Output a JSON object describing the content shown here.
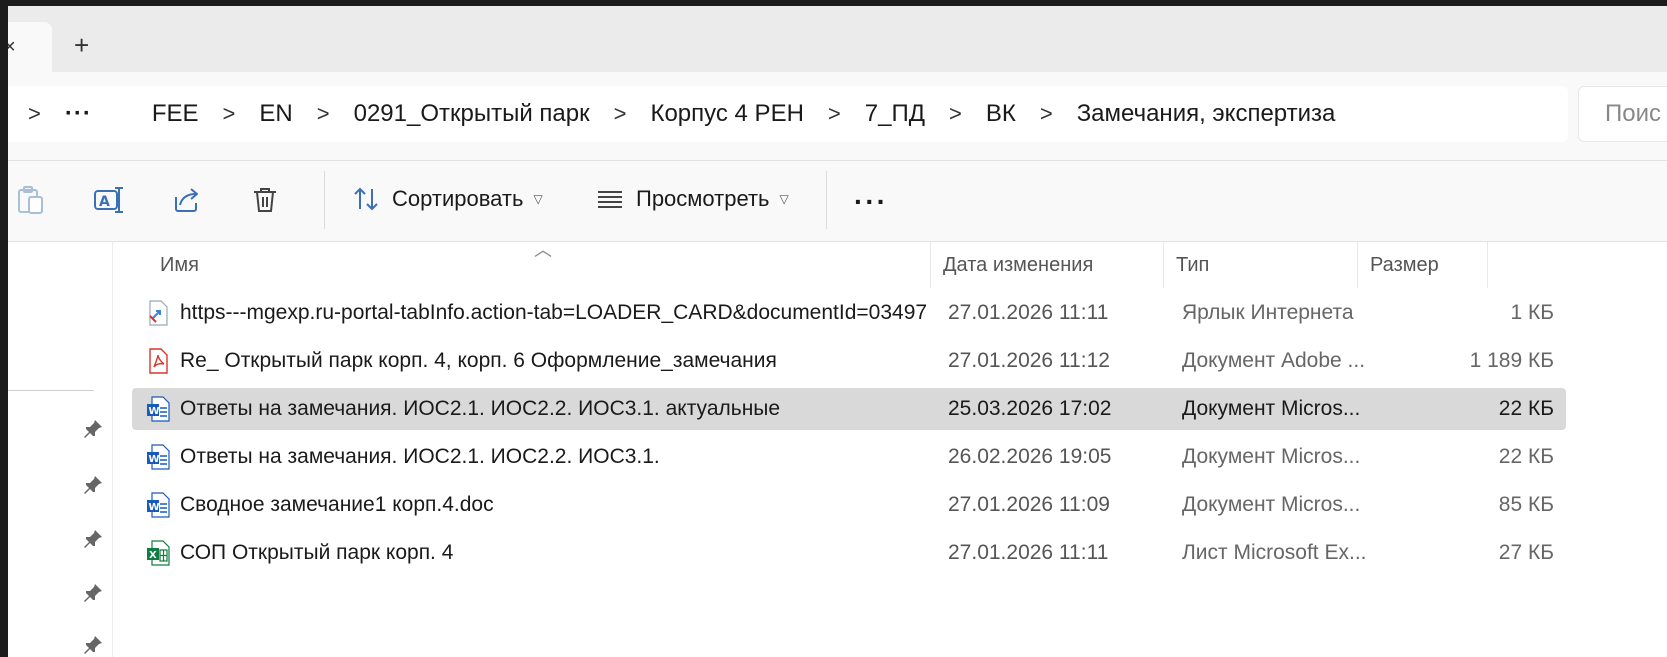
{
  "tabs": {
    "close_glyph": "×",
    "new_tab_glyph": "+"
  },
  "breadcrumb": {
    "partial_first": ")",
    "overflow": "···",
    "items": [
      "FEE",
      "EN",
      "0291_Открытый парк",
      "Корпус 4 РЕН",
      "7_ПД",
      "ВК",
      "Замечания, экспертиза"
    ],
    "separator": ">"
  },
  "search": {
    "placeholder": "Поис"
  },
  "toolbar": {
    "sort_label": "Сортировать",
    "view_label": "Просмотреть",
    "more_label": "···",
    "icons": [
      "paste-icon",
      "rename-icon",
      "share-icon",
      "delete-icon",
      "sort-icon",
      "view-icon",
      "more-icon"
    ]
  },
  "columns": {
    "name": "Имя",
    "date": "Дата изменения",
    "type": "Тип",
    "size": "Размер"
  },
  "files": [
    {
      "name": "https---mgexp.ru-portal-tabInfo.action-tab=LOADER_CARD&documentId=03497...",
      "date": "27.01.2026 11:11",
      "type": "Ярлык Интернета",
      "size": "1 КБ",
      "icon": "url-shortcut-icon"
    },
    {
      "name": "Re_ Открытый парк корп. 4, корп. 6 Оформление_замечания",
      "date": "27.01.2026 11:12",
      "type": "Документ Adobe ...",
      "size": "1 189 КБ",
      "icon": "pdf-icon"
    },
    {
      "name": "Ответы на замечания. ИОС2.1. ИОС2.2. ИОС3.1. актуальные",
      "date": "25.03.2026 17:02",
      "type": "Документ Micros...",
      "size": "22 КБ",
      "icon": "word-icon",
      "selected": true
    },
    {
      "name": "Ответы на замечания. ИОС2.1. ИОС2.2. ИОС3.1.",
      "date": "26.02.2026 19:05",
      "type": "Документ Micros...",
      "size": "22 КБ",
      "icon": "word-icon"
    },
    {
      "name": "Сводное замечание1 корп.4.doc",
      "date": "27.01.2026 11:09",
      "type": "Документ Micros...",
      "size": "85 КБ",
      "icon": "word-icon"
    },
    {
      "name": "СОП Открытый парк корп. 4",
      "date": "27.01.2026 11:11",
      "type": "Лист Microsoft Ex...",
      "size": "27 КБ",
      "icon": "excel-icon"
    }
  ],
  "colors": {
    "selection": "#d9d9d9",
    "accent": "#0067c0",
    "word_blue": "#185abd",
    "pdf_red": "#d9352c",
    "excel_green": "#107c41"
  }
}
